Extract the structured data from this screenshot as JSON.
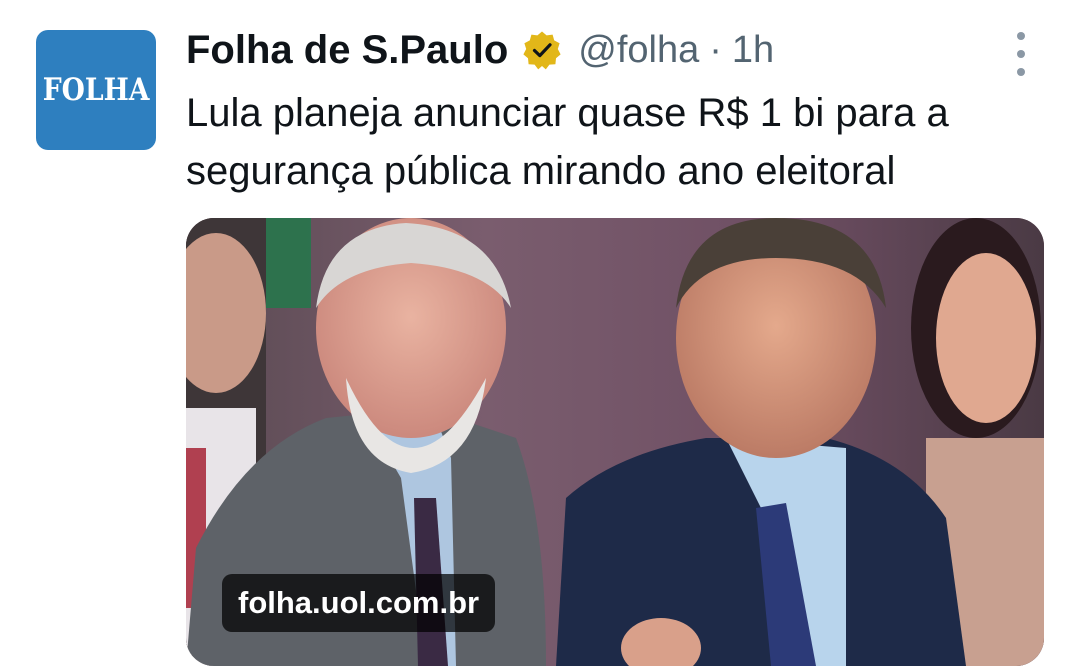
{
  "account": {
    "avatar_text": "FOLHA",
    "display_name": "Folha de S.Paulo",
    "handle": "@folha",
    "separator": "·",
    "time": "1h",
    "verified_icon": "verified-badge-gold"
  },
  "tweet": {
    "text": "Lula planeja anunciar quase R$ 1 bi para a segurança pública mirando ano eleitoral"
  },
  "media": {
    "link_domain": "folha.uol.com.br"
  },
  "colors": {
    "avatar_bg": "#2e7fbf",
    "verified_gold": "#e2b719",
    "secondary_text": "#536471"
  }
}
